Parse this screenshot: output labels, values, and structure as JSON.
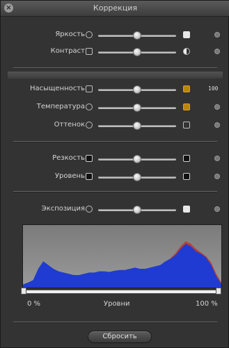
{
  "window": {
    "title": "Коррекция"
  },
  "rows": [
    {
      "id": "brightness",
      "label": "Яркость",
      "value": 0.5
    },
    {
      "id": "contrast",
      "label": "Контраст",
      "value": 0.5
    },
    {
      "id": "saturation",
      "label": "Насыщенность",
      "value": 0.5,
      "badge": "100"
    },
    {
      "id": "temperature",
      "label": "Температура",
      "value": 0.5
    },
    {
      "id": "tint",
      "label": "Оттенок",
      "value": 0.5
    },
    {
      "id": "sharpness",
      "label": "Резкость",
      "value": 0.5
    },
    {
      "id": "noise",
      "label": "Уровень",
      "value": 0.5
    },
    {
      "id": "exposure",
      "label": "Экспозиция",
      "value": 0.5
    }
  ],
  "levels": {
    "min_label": "0 %",
    "center_label": "Уровни",
    "max_label": "100 %",
    "min_value": 0,
    "max_value": 1
  },
  "histogram": {
    "blue": [
      0.05,
      0.08,
      0.12,
      0.3,
      0.42,
      0.36,
      0.3,
      0.26,
      0.24,
      0.22,
      0.2,
      0.2,
      0.22,
      0.24,
      0.24,
      0.26,
      0.26,
      0.25,
      0.27,
      0.28,
      0.28,
      0.3,
      0.32,
      0.3,
      0.3,
      0.32,
      0.34,
      0.36,
      0.42,
      0.46,
      0.52,
      0.62,
      0.7,
      0.66,
      0.58,
      0.54,
      0.48,
      0.36,
      0.18,
      0.06
    ],
    "red": [
      0.04,
      0.07,
      0.1,
      0.26,
      0.38,
      0.33,
      0.27,
      0.24,
      0.22,
      0.2,
      0.19,
      0.19,
      0.21,
      0.23,
      0.23,
      0.25,
      0.25,
      0.24,
      0.26,
      0.27,
      0.27,
      0.29,
      0.31,
      0.29,
      0.29,
      0.31,
      0.33,
      0.35,
      0.41,
      0.47,
      0.55,
      0.66,
      0.74,
      0.7,
      0.62,
      0.56,
      0.5,
      0.4,
      0.22,
      0.08
    ],
    "green": [
      0.04,
      0.07,
      0.11,
      0.28,
      0.4,
      0.34,
      0.28,
      0.25,
      0.23,
      0.21,
      0.19,
      0.19,
      0.21,
      0.23,
      0.23,
      0.25,
      0.25,
      0.24,
      0.26,
      0.27,
      0.27,
      0.29,
      0.31,
      0.29,
      0.29,
      0.31,
      0.33,
      0.35,
      0.4,
      0.44,
      0.5,
      0.6,
      0.68,
      0.64,
      0.56,
      0.52,
      0.46,
      0.34,
      0.16,
      0.05
    ],
    "colors": {
      "blue": "#1f3bd1",
      "red": "#c0392b",
      "green": "#3a8a3a"
    }
  },
  "footer": {
    "reset_label": "Сбросить"
  }
}
